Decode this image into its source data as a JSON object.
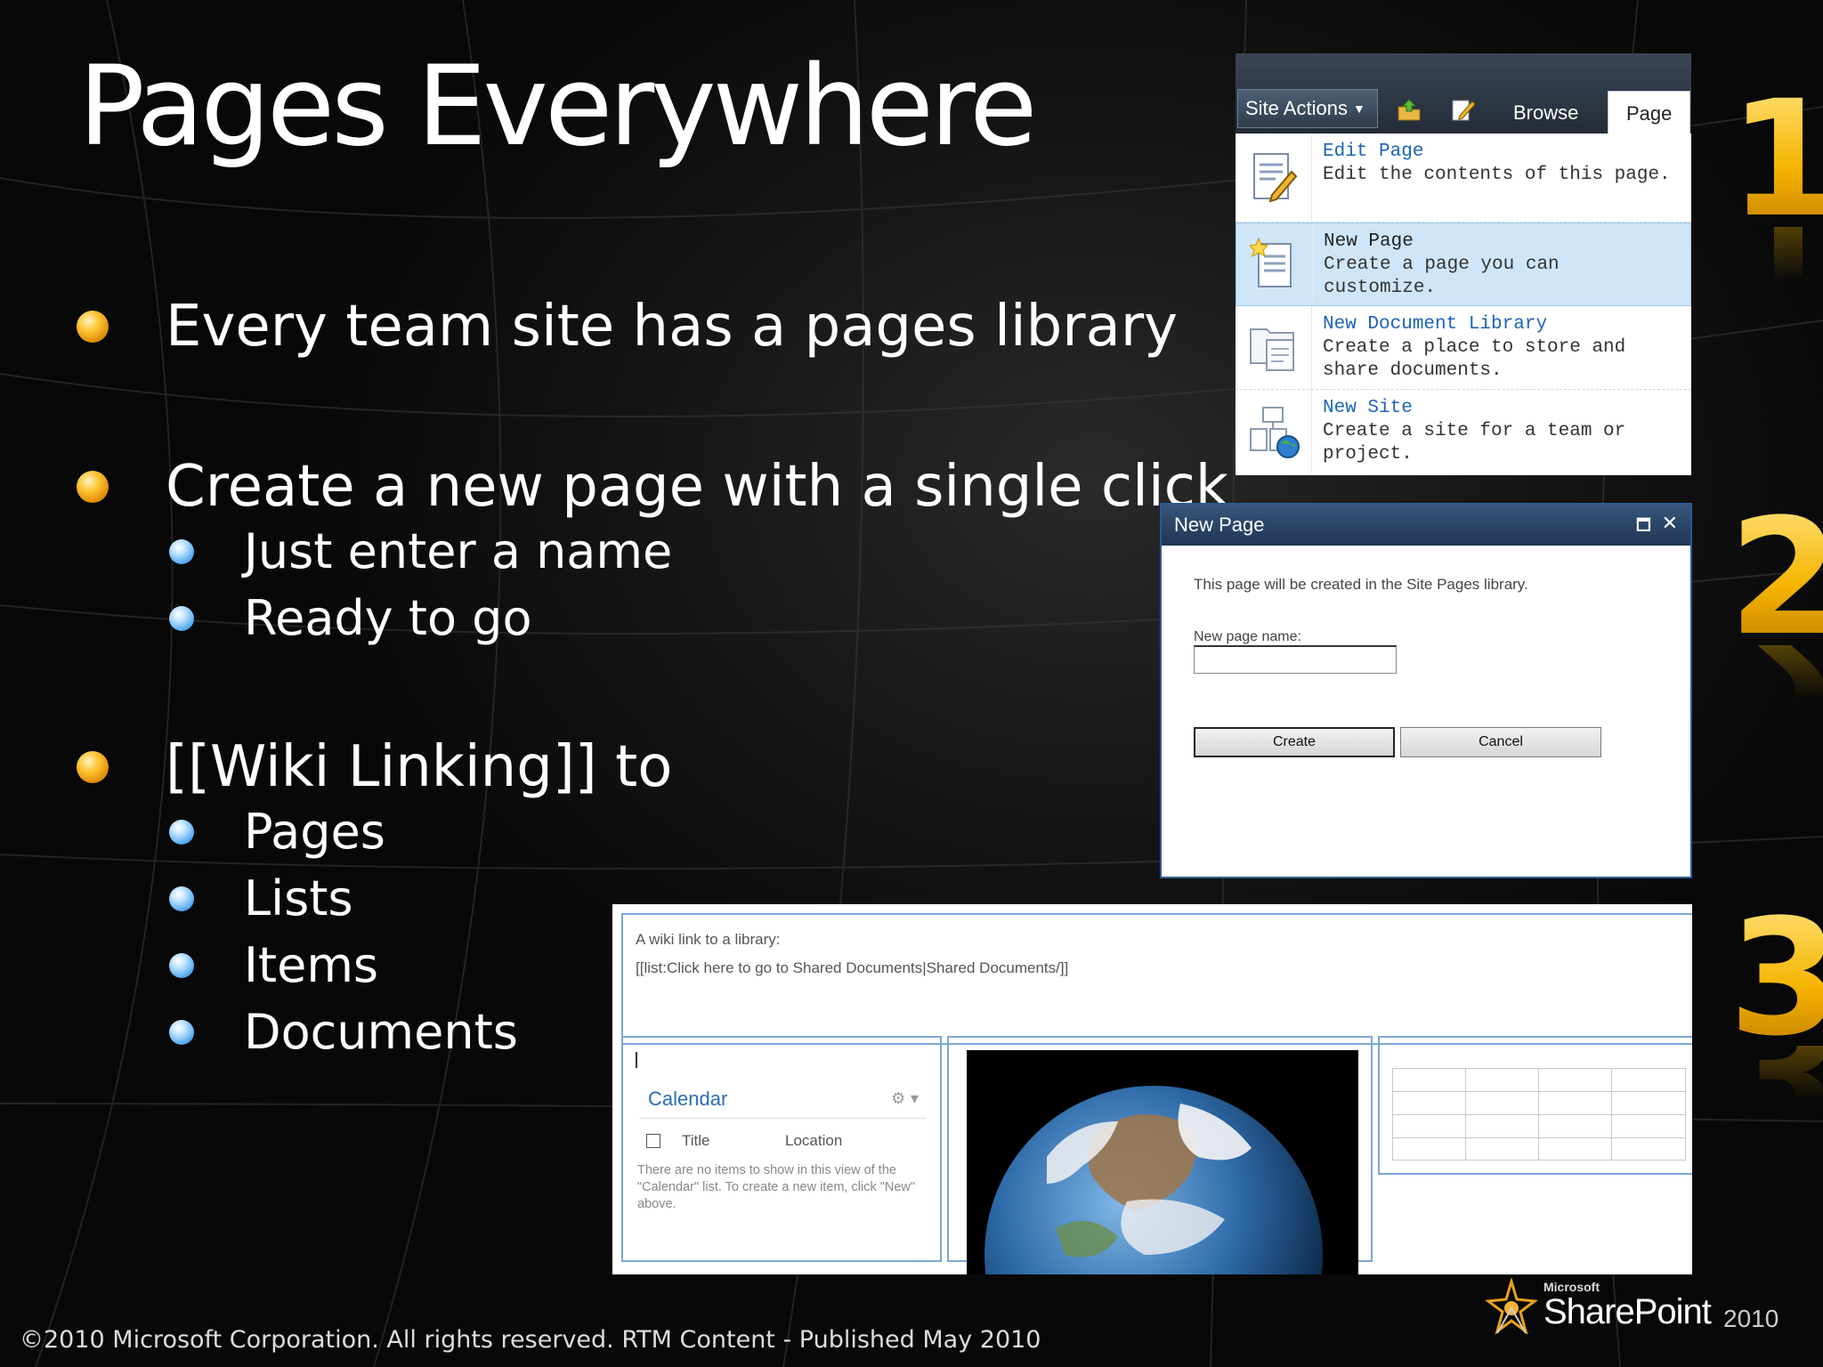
{
  "slide": {
    "title": "Pages Everywhere",
    "bullets": [
      {
        "text": "Every team site has a pages library",
        "sub": []
      },
      {
        "text": "Create a new page with a single click",
        "sub": [
          "Just enter a name",
          "Ready to go"
        ]
      },
      {
        "text": "[[Wiki Linking]] to",
        "sub": [
          "Pages",
          "Lists",
          "Items",
          "Documents"
        ]
      }
    ],
    "step_numbers": [
      "1",
      "2",
      "3"
    ],
    "footer": "©2010 Microsoft Corporation. All rights reserved. RTM Content - Published May 2010",
    "logo": {
      "microsoft": "Microsoft",
      "product": "SharePoint",
      "year": "2010"
    }
  },
  "site_actions_menu": {
    "button_label": "Site Actions",
    "tabs": [
      "Browse",
      "Page"
    ],
    "active_tab": "Page",
    "items": [
      {
        "title": "Edit Page",
        "desc1": "Edit the contents of this page.",
        "desc2": "",
        "icon": "edit-page-icon"
      },
      {
        "title": "New Page",
        "desc1": "Create a page you can",
        "desc2": "customize.",
        "icon": "new-page-icon"
      },
      {
        "title": "New Document Library",
        "desc1": "Create a place to store and",
        "desc2": "share documents.",
        "icon": "document-library-icon"
      },
      {
        "title": "New Site",
        "desc1": "Create a site for a team or",
        "desc2": "project.",
        "icon": "new-site-icon"
      }
    ]
  },
  "new_page_dialog": {
    "title": "New Page",
    "message": "This page will be created in the Site Pages library.",
    "field_label": "New page name:",
    "field_value": "",
    "create_label": "Create",
    "cancel_label": "Cancel"
  },
  "wiki_page": {
    "intro": "A wiki link to a library:",
    "markup": "[[list:Click here to go to Shared Documents|Shared Documents/]]",
    "calendar": {
      "title": "Calendar",
      "col_title": "Title",
      "col_location": "Location",
      "empty_message": "There are no items to show in this view of the \"Calendar\" list. To create a new item, click \"New\" above."
    }
  },
  "colors": {
    "bullet_primary": "#f5a300",
    "bullet_secondary": "#4aa3ee",
    "number_gold": "#f5b400",
    "link_blue": "#1d63b8"
  }
}
